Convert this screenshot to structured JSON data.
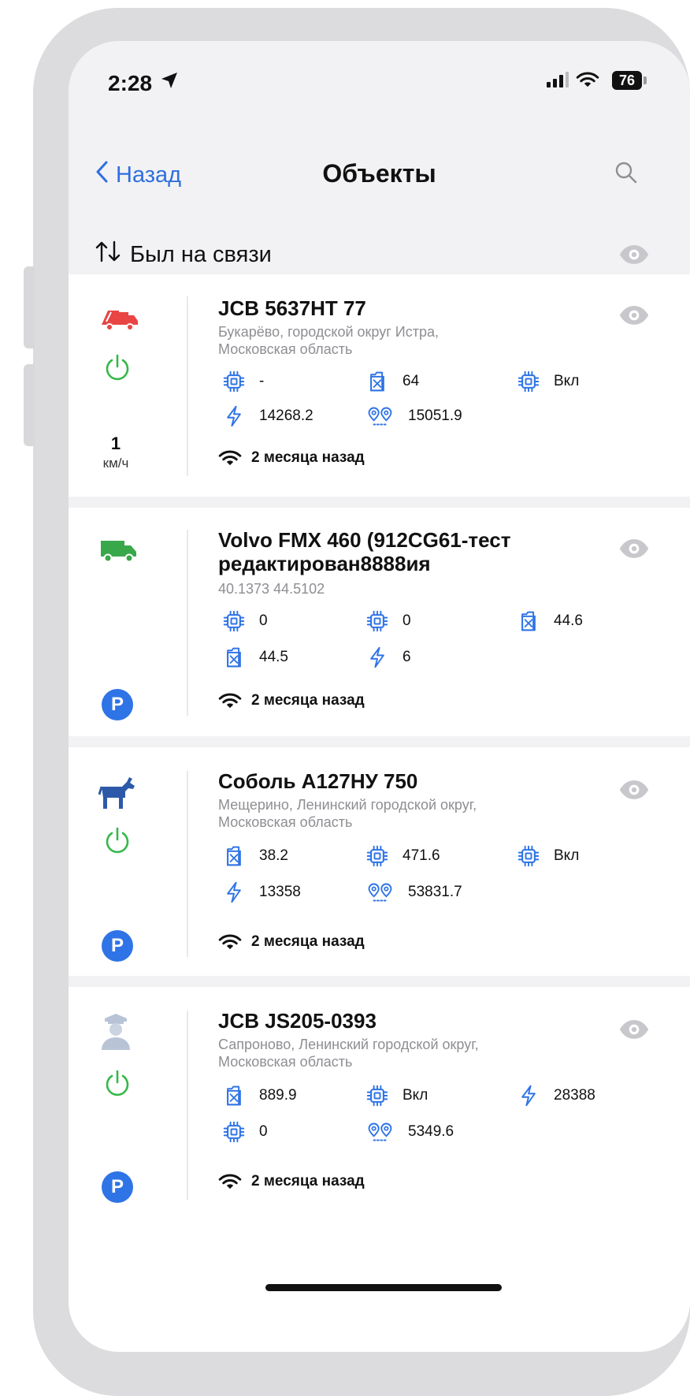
{
  "status": {
    "time": "2:28",
    "battery": "76"
  },
  "nav": {
    "back_label": "Назад",
    "title": "Объекты"
  },
  "sort": {
    "label": "Был на связи"
  },
  "colors": {
    "accent": "#2f6fde",
    "power_green": "#35b84a",
    "vehicle_red": "#e94545",
    "vehicle_green": "#39a84a",
    "vehicle_blue": "#2c5aa8"
  },
  "objects": [
    {
      "name": "JCB 5637HT 77",
      "address_line1": "Букарёво, городской округ Истра,",
      "address_line2": "Московская область",
      "icon": "garbage-truck-icon",
      "power_on": true,
      "speed_value": "1",
      "speed_unit": "км/ч",
      "metrics": [
        {
          "icon": "chip-icon",
          "value": "-"
        },
        {
          "icon": "fuel-icon",
          "value": "64"
        },
        {
          "icon": "chip-icon",
          "value": "Вкл"
        },
        {
          "icon": "bolt-icon",
          "value": "14268.2"
        },
        {
          "icon": "mileage-icon",
          "value": "15051.9"
        }
      ],
      "last_seen": "2 месяца назад"
    },
    {
      "name_line1": "Volvo FMX 460 (912CG61-тест",
      "name_line2": "редактирован8888ия",
      "coords": "40.1373 44.5102",
      "icon": "van-icon",
      "parked": "P",
      "metrics": [
        {
          "icon": "chip-icon",
          "value": "0"
        },
        {
          "icon": "chip-icon",
          "value": "0"
        },
        {
          "icon": "fuel-icon",
          "value": "44.6"
        },
        {
          "icon": "fuel-icon",
          "value": "44.5"
        },
        {
          "icon": "bolt-icon",
          "value": "6"
        }
      ],
      "last_seen": "2 месяца назад"
    },
    {
      "name": "Соболь А127НУ 750",
      "address_line1": "Мещерино, Ленинский городской округ,",
      "address_line2": "Московская область",
      "icon": "goat-icon",
      "power_on": true,
      "parked": "P",
      "metrics": [
        {
          "icon": "fuel-icon",
          "value": "38.2"
        },
        {
          "icon": "chip-icon",
          "value": "471.6"
        },
        {
          "icon": "chip-icon",
          "value": "Вкл"
        },
        {
          "icon": "bolt-icon",
          "value": "13358"
        },
        {
          "icon": "mileage-icon",
          "value": "53831.7"
        }
      ],
      "last_seen": "2 месяца назад"
    },
    {
      "name": "JCB JS205-0393",
      "address_line1": "Сапроново, Ленинский городской округ,",
      "address_line2": "Московская область",
      "icon": "officer-icon",
      "power_on": true,
      "parked": "P",
      "metrics": [
        {
          "icon": "fuel-icon",
          "value": "889.9"
        },
        {
          "icon": "chip-icon",
          "value": "Вкл"
        },
        {
          "icon": "bolt-icon",
          "value": "28388"
        },
        {
          "icon": "chip-icon",
          "value": "0"
        },
        {
          "icon": "mileage-icon",
          "value": "5349.6"
        }
      ],
      "last_seen": "2 месяца назад"
    }
  ]
}
